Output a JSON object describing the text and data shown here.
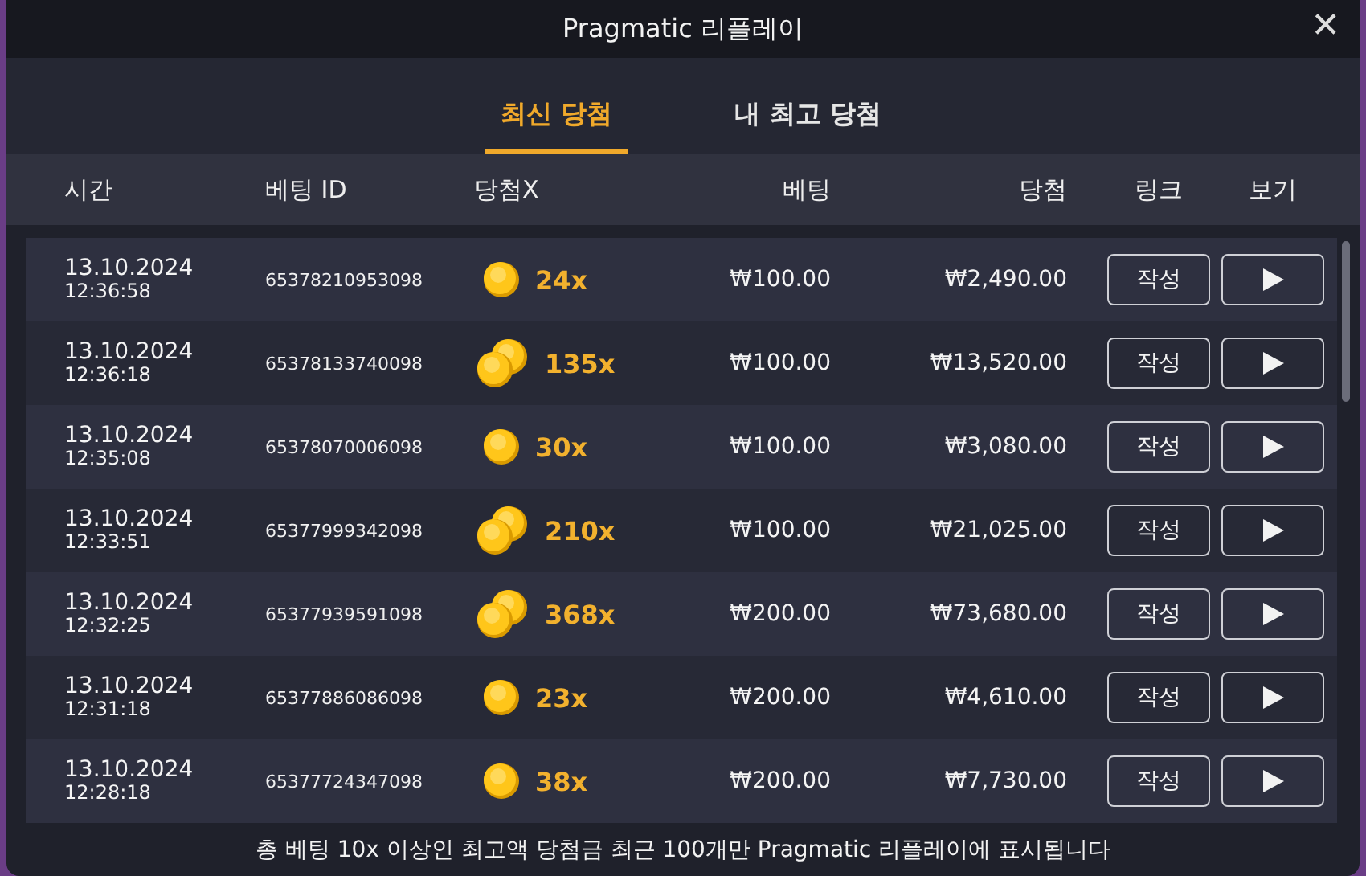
{
  "window": {
    "title": "Pragmatic 리플레이",
    "close": "✕"
  },
  "tabs": [
    {
      "label": "최신 당첨",
      "selected": true
    },
    {
      "label": "내 최고 당첨",
      "selected": false
    }
  ],
  "table": {
    "columns": [
      "시간",
      "베팅 ID",
      "당첨X",
      "베팅",
      "당첨",
      "링크",
      "보기"
    ],
    "rows": [
      {
        "date": "13.10.2024",
        "time": "12:36:58",
        "bet_id": "65378210953098",
        "kind": "single",
        "multiplier": "24x",
        "bet": "₩100.00",
        "win": "₩2,490.00",
        "link": "작성"
      },
      {
        "date": "13.10.2024",
        "time": "12:36:18",
        "bet_id": "65378133740098",
        "kind": "double",
        "multiplier": "135x",
        "bet": "₩100.00",
        "win": "₩13,520.00",
        "link": "작성"
      },
      {
        "date": "13.10.2024",
        "time": "12:35:08",
        "bet_id": "65378070006098",
        "kind": "single",
        "multiplier": "30x",
        "bet": "₩100.00",
        "win": "₩3,080.00",
        "link": "작성"
      },
      {
        "date": "13.10.2024",
        "time": "12:33:51",
        "bet_id": "65377999342098",
        "kind": "double",
        "multiplier": "210x",
        "bet": "₩100.00",
        "win": "₩21,025.00",
        "link": "작성"
      },
      {
        "date": "13.10.2024",
        "time": "12:32:25",
        "bet_id": "65377939591098",
        "kind": "double",
        "multiplier": "368x",
        "bet": "₩200.00",
        "win": "₩73,680.00",
        "link": "작성"
      },
      {
        "date": "13.10.2024",
        "time": "12:31:18",
        "bet_id": "65377886086098",
        "kind": "single",
        "multiplier": "23x",
        "bet": "₩200.00",
        "win": "₩4,610.00",
        "link": "작성"
      },
      {
        "date": "13.10.2024",
        "time": "12:28:18",
        "bet_id": "65377724347098",
        "kind": "single",
        "multiplier": "38x",
        "bet": "₩200.00",
        "win": "₩7,730.00",
        "link": "작성"
      }
    ]
  },
  "footer": "총 베팅 10x 이상인 최고액 당첨금 최근 100개만 Pragmatic 리플레이에 표시됩니다"
}
